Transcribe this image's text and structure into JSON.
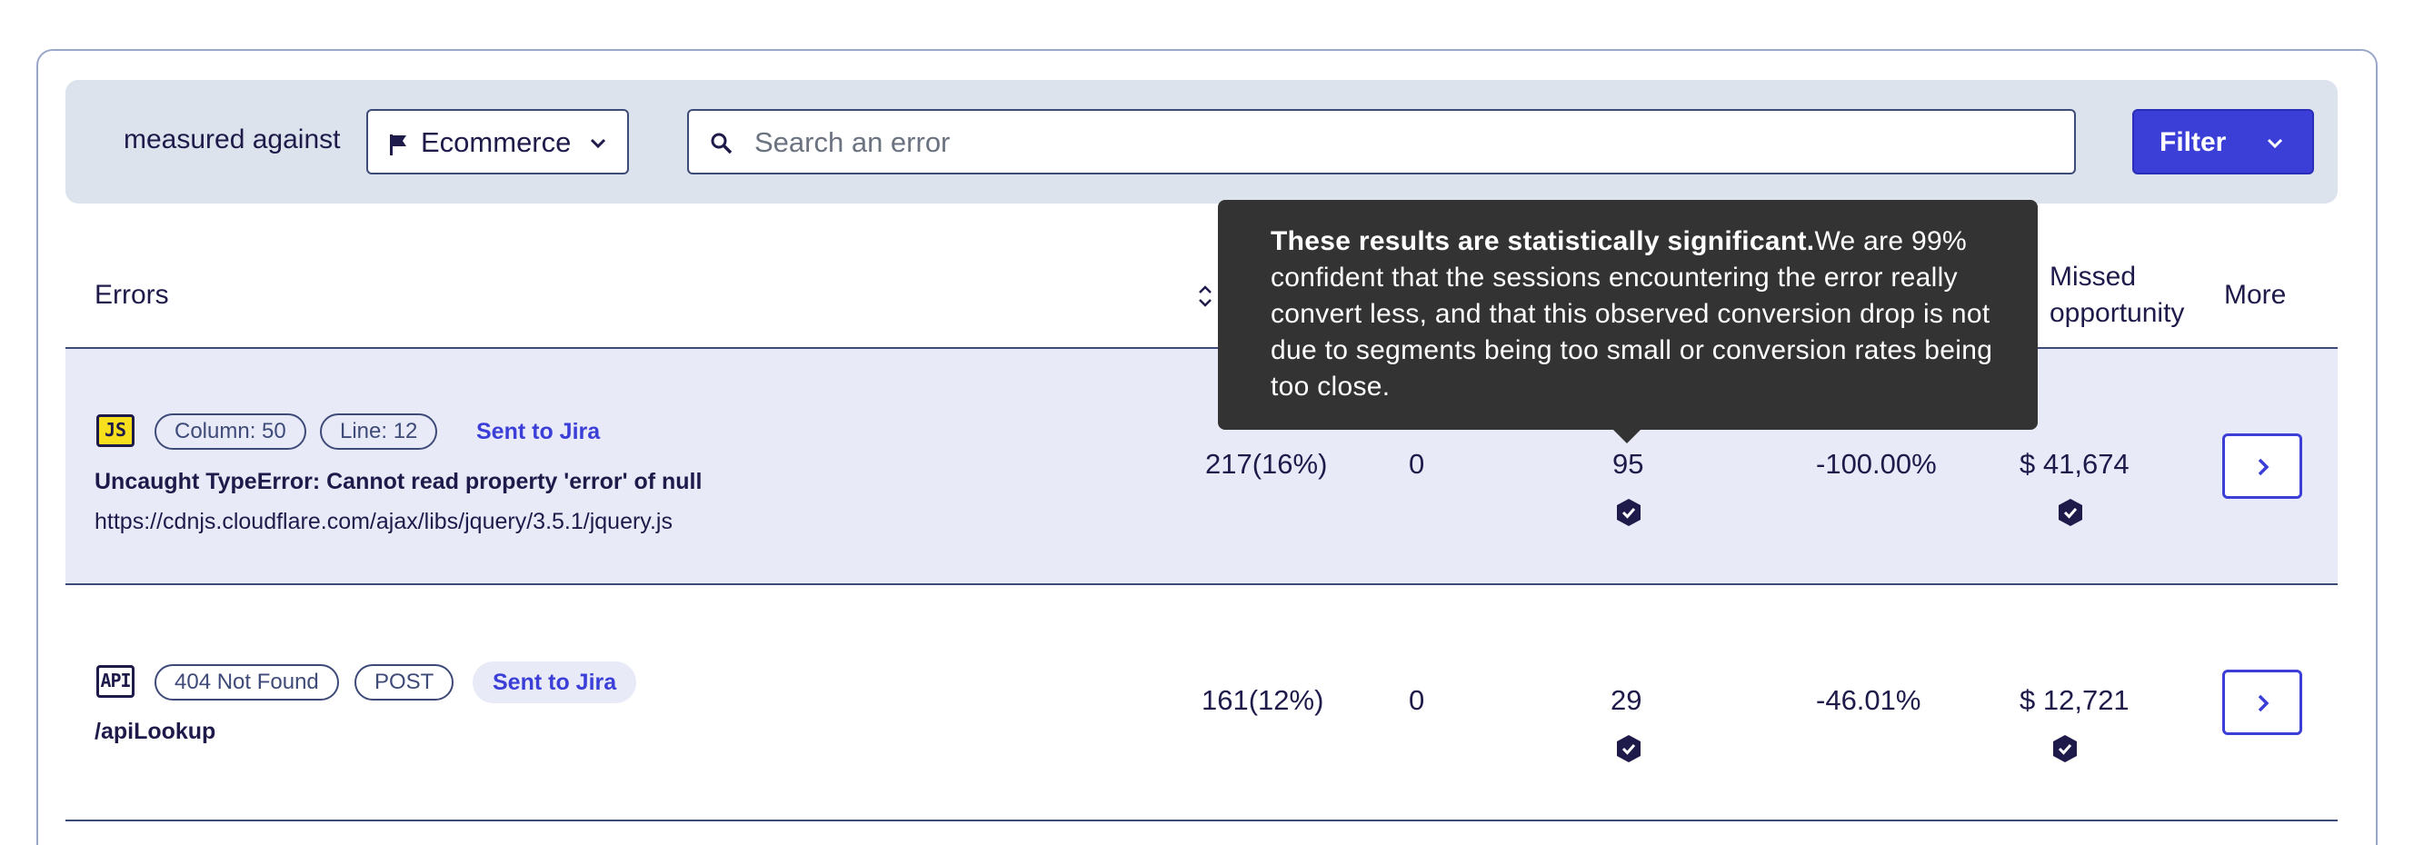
{
  "filters": {
    "measured_label": "measured against",
    "goal_dropdown": {
      "value": "Ecommerce",
      "icon": "flag-icon"
    },
    "search": {
      "placeholder": "Search an error",
      "value": ""
    },
    "filter_button": {
      "label": "Filter"
    }
  },
  "table": {
    "headers": {
      "errors": "Errors",
      "missed_opportunity": "Missed opportunity",
      "more": "More"
    },
    "rows": [
      {
        "type_badge": "JS",
        "tags": [
          "Column: 50",
          "Line: 12"
        ],
        "jira_label": "Sent to Jira",
        "title": "Uncaught TypeError: Cannot read property 'error' of null",
        "subtitle": "https://cdnjs.cloudflare.com/ajax/libs/jquery/3.5.1/jquery.js",
        "sessions": "217(16%)",
        "col2": "0",
        "col3": "95",
        "col4": "-100.00%",
        "missed_opportunity": "$ 41,674"
      },
      {
        "type_badge": "API",
        "tags": [
          "404 Not Found",
          "POST"
        ],
        "jira_label": "Sent to Jira",
        "title": "",
        "subtitle": "/apiLookup",
        "sessions": "161(12%)",
        "col2": "0",
        "col3": "29",
        "col4": "-46.01%",
        "missed_opportunity": "$ 12,721"
      }
    ]
  },
  "tooltip": {
    "bold": "These results are statistically significant.",
    "text": "We are 99% confident that the sessions encountering the error really convert less, and that this observed conversion drop is not due to segments being too small or conversion rates being too close."
  },
  "colors": {
    "accent": "#3b3fd8",
    "navy": "#1e1b4b",
    "filter_bg": "#dde3ec",
    "row_highlight": "#e8eaf8",
    "tooltip_bg": "#333333"
  }
}
